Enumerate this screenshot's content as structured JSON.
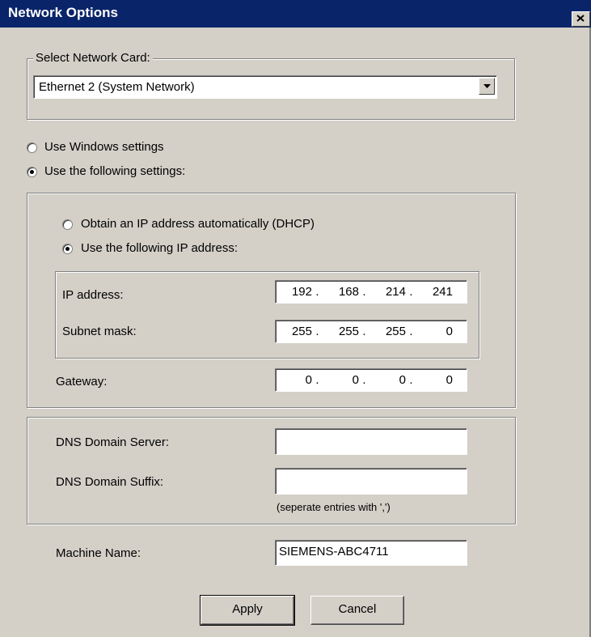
{
  "window": {
    "title": "Network Options",
    "close_symbol": "×"
  },
  "network_card": {
    "legend": "Select Network Card:",
    "selected": "Ethernet 2 (System Network)"
  },
  "mode": {
    "windows_label": "Use Windows settings",
    "following_label": "Use the following settings:",
    "selected": "following"
  },
  "ip_mode": {
    "dhcp_label": "Obtain an IP address automatically (DHCP)",
    "static_label": "Use the following IP address:",
    "selected": "static"
  },
  "ip_fields": {
    "ip_label": "IP address:",
    "ip": [
      "192",
      "168",
      "214",
      "241"
    ],
    "subnet_label": "Subnet mask:",
    "subnet": [
      "255",
      "255",
      "255",
      "0"
    ],
    "gateway_label": "Gateway:",
    "gateway": [
      "0",
      "0",
      "0",
      "0"
    ]
  },
  "dns": {
    "server_label": "DNS Domain Server:",
    "server_value": "",
    "suffix_label": "DNS Domain Suffix:",
    "suffix_value": "",
    "hint": "(seperate entries with ',')"
  },
  "machine": {
    "label": "Machine Name:",
    "value": "SIEMENS-ABC4711"
  },
  "buttons": {
    "apply": "Apply",
    "cancel": "Cancel"
  }
}
